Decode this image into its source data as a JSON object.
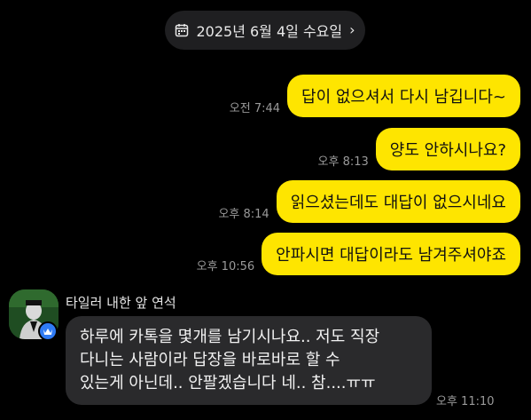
{
  "date_header": {
    "label": "2025년 6월 4일 수요일",
    "icon": "calendar-icon",
    "chevron": "chevron-right-icon"
  },
  "colors": {
    "background": "#000000",
    "outgoing_bubble": "#fee500",
    "incoming_bubble": "#2a2a2c",
    "timestamp": "#9a9a9a",
    "verified_badge": "#2f7bf5"
  },
  "outgoing_messages": [
    {
      "text": "답이 없으셔서 다시 남깁니다~",
      "time": "오전 7:44"
    },
    {
      "text": "양도 안하시나요?",
      "time": "오후 8:13"
    },
    {
      "text": "읽으셨는데도 대답이 없으시네요",
      "time": "오후 8:14"
    },
    {
      "text": "안파시면 대답이라도 남겨주셔야죠",
      "time": "오후 10:56"
    }
  ],
  "incoming_message": {
    "sender": "타일러 내한 앞 연석",
    "lines": [
      "하루에 카톡을 몇개를 남기시나요.. 저도 직장",
      "다니는 사람이라 답장을 바로바로 할 수",
      "있는게 아닌데.. 안팔겠습니다 네.. 참....ㅠㅠ"
    ],
    "time": "오후 11:10"
  }
}
